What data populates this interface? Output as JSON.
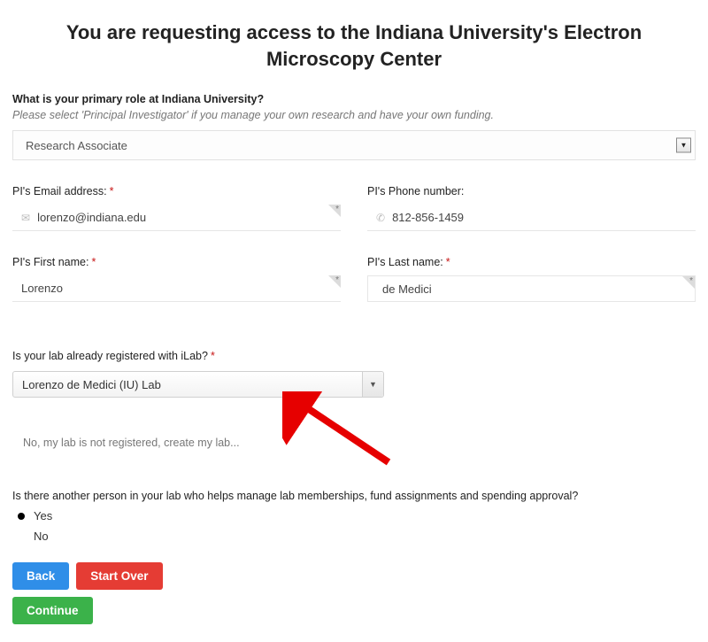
{
  "title": "You are requesting access to the Indiana University's Electron Microscopy Center",
  "role": {
    "question": "What is your primary role at Indiana University?",
    "hint": "Please select 'Principal Investigator' if you manage your own research and have your own funding.",
    "selected": "Research Associate"
  },
  "pi": {
    "email": {
      "label": "PI's Email address:",
      "value": "lorenzo@indiana.edu"
    },
    "phone": {
      "label": "PI's Phone number:",
      "value": "812-856-1459"
    },
    "first": {
      "label": "PI's First name:",
      "value": "Lorenzo"
    },
    "last": {
      "label": "PI's Last name:",
      "value": "de Medici"
    }
  },
  "lab": {
    "question": "Is your lab already registered with iLab?",
    "selected": "Lorenzo de Medici (IU) Lab",
    "create_label": "No, my lab is not registered, create my lab..."
  },
  "helper": {
    "question": "Is there another person in your lab who helps manage lab memberships, fund assignments and spending approval?",
    "options": {
      "yes": "Yes",
      "no": "No"
    },
    "selected": "yes"
  },
  "buttons": {
    "back": "Back",
    "start_over": "Start Over",
    "continue": "Continue"
  }
}
